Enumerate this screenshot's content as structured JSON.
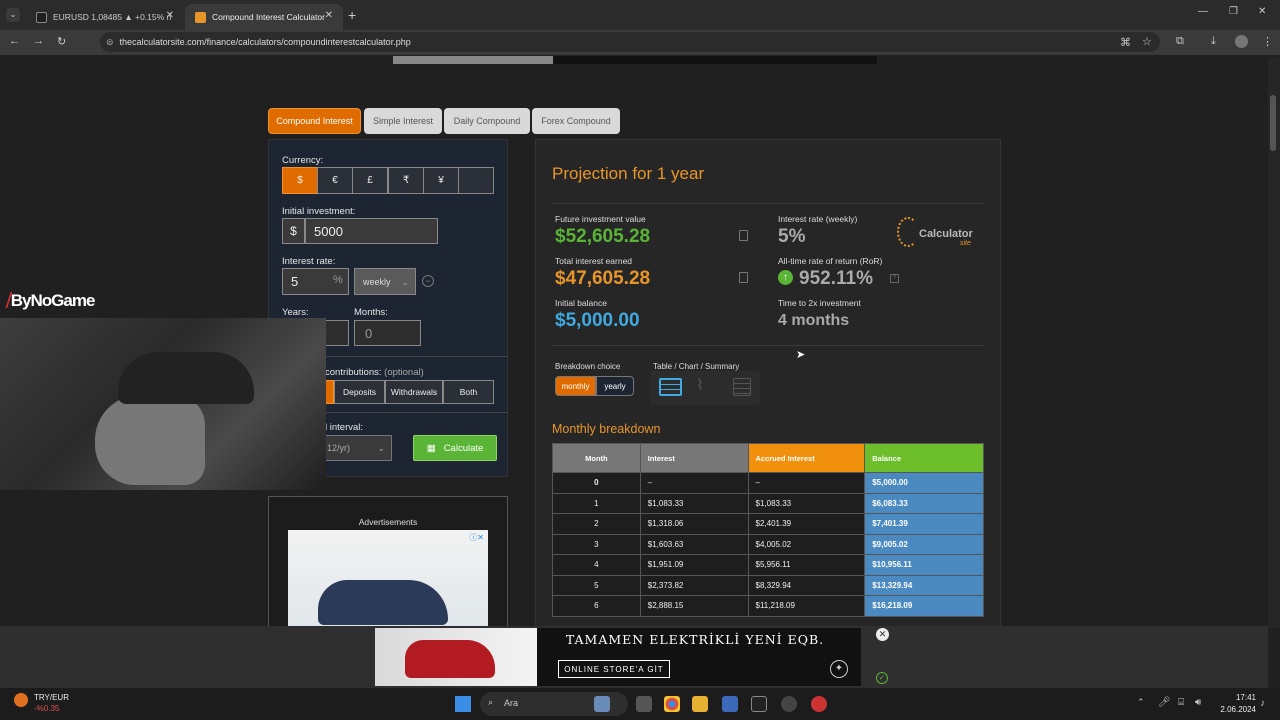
{
  "browser": {
    "tabs": [
      {
        "title": "EURUSD 1,08485 ▲ +0.15% n",
        "active": false
      },
      {
        "title": "Compound Interest Calculator",
        "active": true
      }
    ],
    "url": "thecalculatorsite.com/finance/calculators/compoundinterestcalculator.php"
  },
  "calc_tabs": [
    "Compound Interest",
    "Simple Interest",
    "Daily Compound",
    "Forex Compound"
  ],
  "form": {
    "currency_label": "Currency:",
    "currencies": [
      "$",
      "€",
      "£",
      "₹",
      "¥",
      ""
    ],
    "initial_label": "Initial investment:",
    "initial_symbol": "$",
    "initial_value": "5000",
    "rate_label": "Interest rate:",
    "rate_value": "5",
    "rate_unit": "%",
    "rate_period": "weekly",
    "years_label": "Years:",
    "months_label": "Months:",
    "months_value": "0",
    "contrib_label": "contributions:",
    "contrib_optional": "(optional)",
    "contrib_options": [
      "Deposits",
      "Withdrawals",
      "Both"
    ],
    "interval_label": "l interval:",
    "interval_value": "12/yr)",
    "calculate": "Calculate",
    "ads_label": "Advertisements"
  },
  "results": {
    "title": "Projection for 1 year",
    "future_label": "Future investment value",
    "future_value": "$52,605.28",
    "interest_label": "Total interest earned",
    "interest_value": "$47,605.28",
    "initial_label": "Initial balance",
    "initial_value": "$5,000.00",
    "rate_label": "Interest rate (weekly)",
    "rate_value": "5%",
    "ror_label": "All-time rate of return (RoR)",
    "ror_value": "952.11%",
    "double_label": "Time to 2x investment",
    "double_value": "4 months",
    "logo_text": "Calculator",
    "logo_sub": "site",
    "breakdown_label": "Breakdown choice",
    "breakdown_options": [
      "monthly",
      "yearly"
    ],
    "view_label": "Table / Chart / Summary",
    "monthly_title": "Monthly breakdown",
    "table_headers": [
      "Month",
      "Interest",
      "Accrued Interest",
      "Balance"
    ],
    "table_rows": [
      [
        "0",
        "–",
        "–",
        "$5,000.00"
      ],
      [
        "1",
        "$1,083.33",
        "$1,083.33",
        "$6,083.33"
      ],
      [
        "2",
        "$1,318.06",
        "$2,401.39",
        "$7,401.39"
      ],
      [
        "3",
        "$1,603.63",
        "$4,005.02",
        "$9,005.02"
      ],
      [
        "4",
        "$1,951.09",
        "$5,956.11",
        "$10,956.11"
      ],
      [
        "5",
        "$2,373.82",
        "$8,329.94",
        "$13,329.94"
      ],
      [
        "6",
        "$2,888.15",
        "$11,218.09",
        "$16,218.09"
      ]
    ],
    "colors": {
      "green": "#5ab536",
      "orange": "#e8962a",
      "blue": "#3fa9e0"
    }
  },
  "overlay": {
    "brand": "ByNoGame"
  },
  "bottom_ad": {
    "title": "TAMAMEN ELEKTRİKLİ YENİ EQB.",
    "button": "ONLINE STORE'A GİT"
  },
  "taskbar": {
    "ticker_name": "TRY/EUR",
    "ticker_change": "-%0.35",
    "search": "Ara",
    "time": "17:41",
    "date": "2.06.2024"
  }
}
